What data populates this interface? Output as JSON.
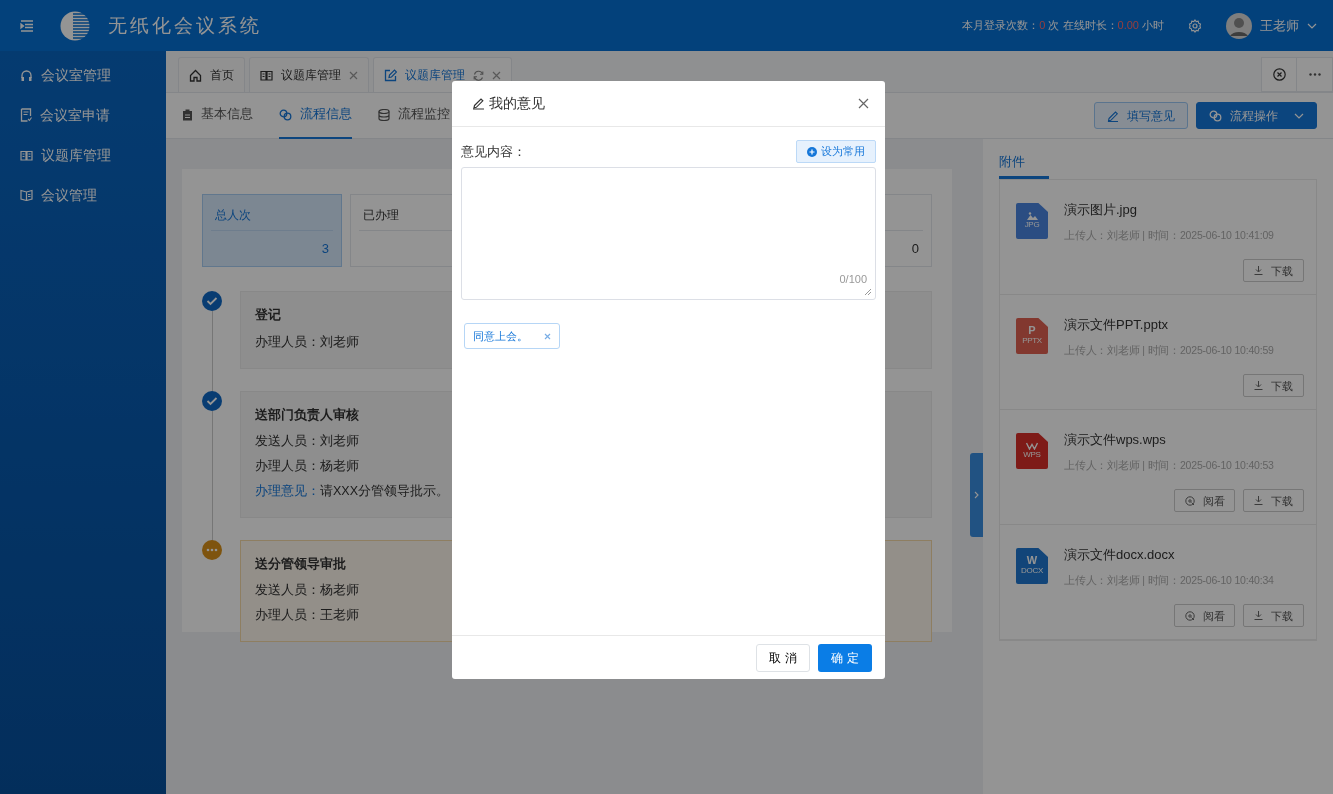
{
  "header": {
    "title": "无纸化会议系统",
    "login_label": "本月登录次数：",
    "login_count": "0",
    "login_unit": "次 在线时长：",
    "online_hours": "0.00",
    "hours_unit": "小时",
    "user": "王老师"
  },
  "sidebar": {
    "items": [
      {
        "label": "会议室管理"
      },
      {
        "label": "会议室申请"
      },
      {
        "label": "议题库管理"
      },
      {
        "label": "会议管理"
      }
    ]
  },
  "tabs": [
    {
      "label": "首页",
      "selected": false,
      "closable": false,
      "refresh": false
    },
    {
      "label": "议题库管理",
      "selected": false,
      "closable": true,
      "refresh": false
    },
    {
      "label": "议题库管理",
      "selected": true,
      "closable": true,
      "refresh": true
    }
  ],
  "sub_tabs": [
    {
      "label": "基本信息",
      "selected": false
    },
    {
      "label": "流程信息",
      "selected": true
    },
    {
      "label": "流程监控",
      "selected": false
    }
  ],
  "actions": [
    {
      "label": "填写意见",
      "kind": "outline"
    },
    {
      "label": "流程操作",
      "kind": "primary"
    }
  ],
  "stats": [
    {
      "label": "总人次",
      "value": "3",
      "selected": true
    },
    {
      "label": "已办理",
      "selected": false
    },
    {
      "value": "0",
      "selected": false
    }
  ],
  "timeline": [
    {
      "title": "登记",
      "done": true,
      "lines": [
        {
          "kind": "person",
          "label": "办理人员：",
          "value": "刘老师"
        }
      ]
    },
    {
      "title": "送部门负责人审核",
      "done": true,
      "lines": [
        {
          "kind": "person",
          "label": "发送人员：",
          "value": "刘老师"
        },
        {
          "kind": "person",
          "label": "办理人员：",
          "value": "杨老师"
        },
        {
          "kind": "opinion",
          "label": "办理意见：",
          "value": "请XXX分管领导批示。"
        }
      ]
    },
    {
      "title": "送分管领导审批",
      "done": false,
      "lines": [
        {
          "kind": "person",
          "label": "发送人员：",
          "value": "杨老师"
        },
        {
          "kind": "person",
          "label": "办理人员：",
          "value": "王老师"
        }
      ]
    }
  ],
  "attachments": {
    "tab": "附件",
    "files": [
      {
        "name": "演示图片.jpg",
        "kind": "jpg",
        "badge": "JPG",
        "meta": "上传人：刘老师 | 时间：2025-06-10 10:41:09",
        "buttons": [
          "下载"
        ]
      },
      {
        "name": "演示文件PPT.pptx",
        "kind": "ppt",
        "letter": "P",
        "badge": "PPTX",
        "meta": "上传人：刘老师 | 时间：2025-06-10 10:40:59",
        "buttons": [
          "下载"
        ]
      },
      {
        "name": "演示文件wps.wps",
        "kind": "wps",
        "badge": "WPS",
        "meta": "上传人：刘老师 | 时间：2025-06-10 10:40:53",
        "buttons": [
          "阅看",
          "下载"
        ]
      },
      {
        "name": "演示文件docx.docx",
        "kind": "docx",
        "letter": "W",
        "badge": "DOCX",
        "meta": "上传人：刘老师 | 时间：2025-06-10 10:40:34",
        "buttons": [
          "阅看",
          "下载"
        ]
      }
    ]
  },
  "modal": {
    "title": "我的意见",
    "field_label": "意见内容：",
    "common_button": "设为常用",
    "counter": "0/100",
    "tags": [
      "同意上会。"
    ],
    "cancel": "取 消",
    "confirm": "确 定"
  }
}
